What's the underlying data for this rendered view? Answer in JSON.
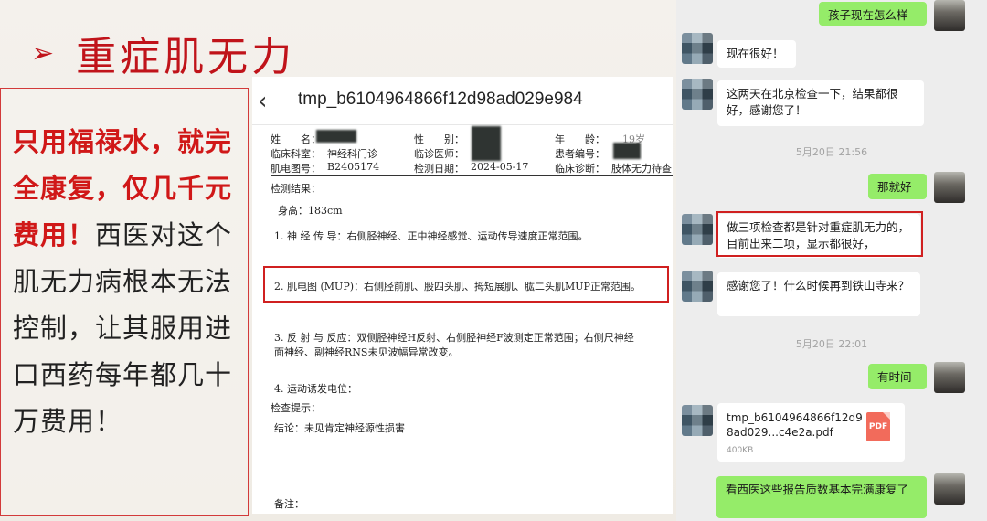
{
  "slide": {
    "title_marker": "➢",
    "title": "重症肌无力",
    "left_text_red": "只用福禄水，就完全康复，仅几千元费用！",
    "left_text_black": "西医对这个肌无力病根本无法控制，让其服用进口西药每年都几十万费用！"
  },
  "document": {
    "back_icon": "chevron-left-icon",
    "file_title": "tmp_b6104964866f12d98ad029e984",
    "row1": {
      "name_label": "姓　　名：",
      "gender_label": "性　　别：",
      "age_label": "年　　龄：",
      "age_value": "19岁"
    },
    "row2": {
      "dept_label": "临床科室：",
      "dept_value": "神经科门诊",
      "doctor_label": "临诊医师：",
      "patient_no_label": "患者编号："
    },
    "row3": {
      "emg_no_label": "肌电图号：",
      "emg_no_value": "B2405174",
      "date_label": "检测日期：",
      "date_value": "2024-05-17",
      "diag_label": "临床诊断：",
      "diag_value": "肢体无力待查"
    },
    "results_label": "检测结果：",
    "height": "身高：183cm",
    "item1": "1. 神 经 传 导：右侧胫神经、正中神经感觉、运动传导速度正常范围。",
    "item2": "2. 肌电图 (MUP)：右侧胫前肌、股四头肌、拇短展肌、肱二头肌MUP正常范围。",
    "item3a": "3. 反 射 与 反应：双侧胫神经H反射、右侧胫神经F波测定正常范围；右侧尺神经",
    "item3b": "面神经、副神经RNS未见波幅异常改变。",
    "item4": "4. 运动诱发电位：",
    "hint_label": "检查提示：",
    "conclusion": "结论：未见肯定神经源性损害",
    "remark": "备注："
  },
  "chat": {
    "msg_out_1": "孩子现在怎么样",
    "msg_in_1": "现在很好！",
    "msg_in_2": "这两天在北京检查一下，结果都很好，感谢您了！",
    "timestamp_1": "5月20日 21:56",
    "msg_out_2": "那就好",
    "msg_in_3": "做三项检查都是针对重症肌无力的，目前出来二项，显示都很好，",
    "msg_in_4": "感谢您了！什么时候再到铁山寺来？",
    "timestamp_2": "5月20日 22:01",
    "msg_out_3": "有时间",
    "file_name": "tmp_b6104964866f12d98ad029...c4e2a.pdf",
    "file_size": "400KB",
    "file_icon_label": "PDF",
    "msg_out_4": "看西医这些报告质数基本完满康复了"
  },
  "colors": {
    "accent_red": "#c0131a",
    "bubble_green": "#95ec69",
    "chat_bg": "#ededed"
  }
}
